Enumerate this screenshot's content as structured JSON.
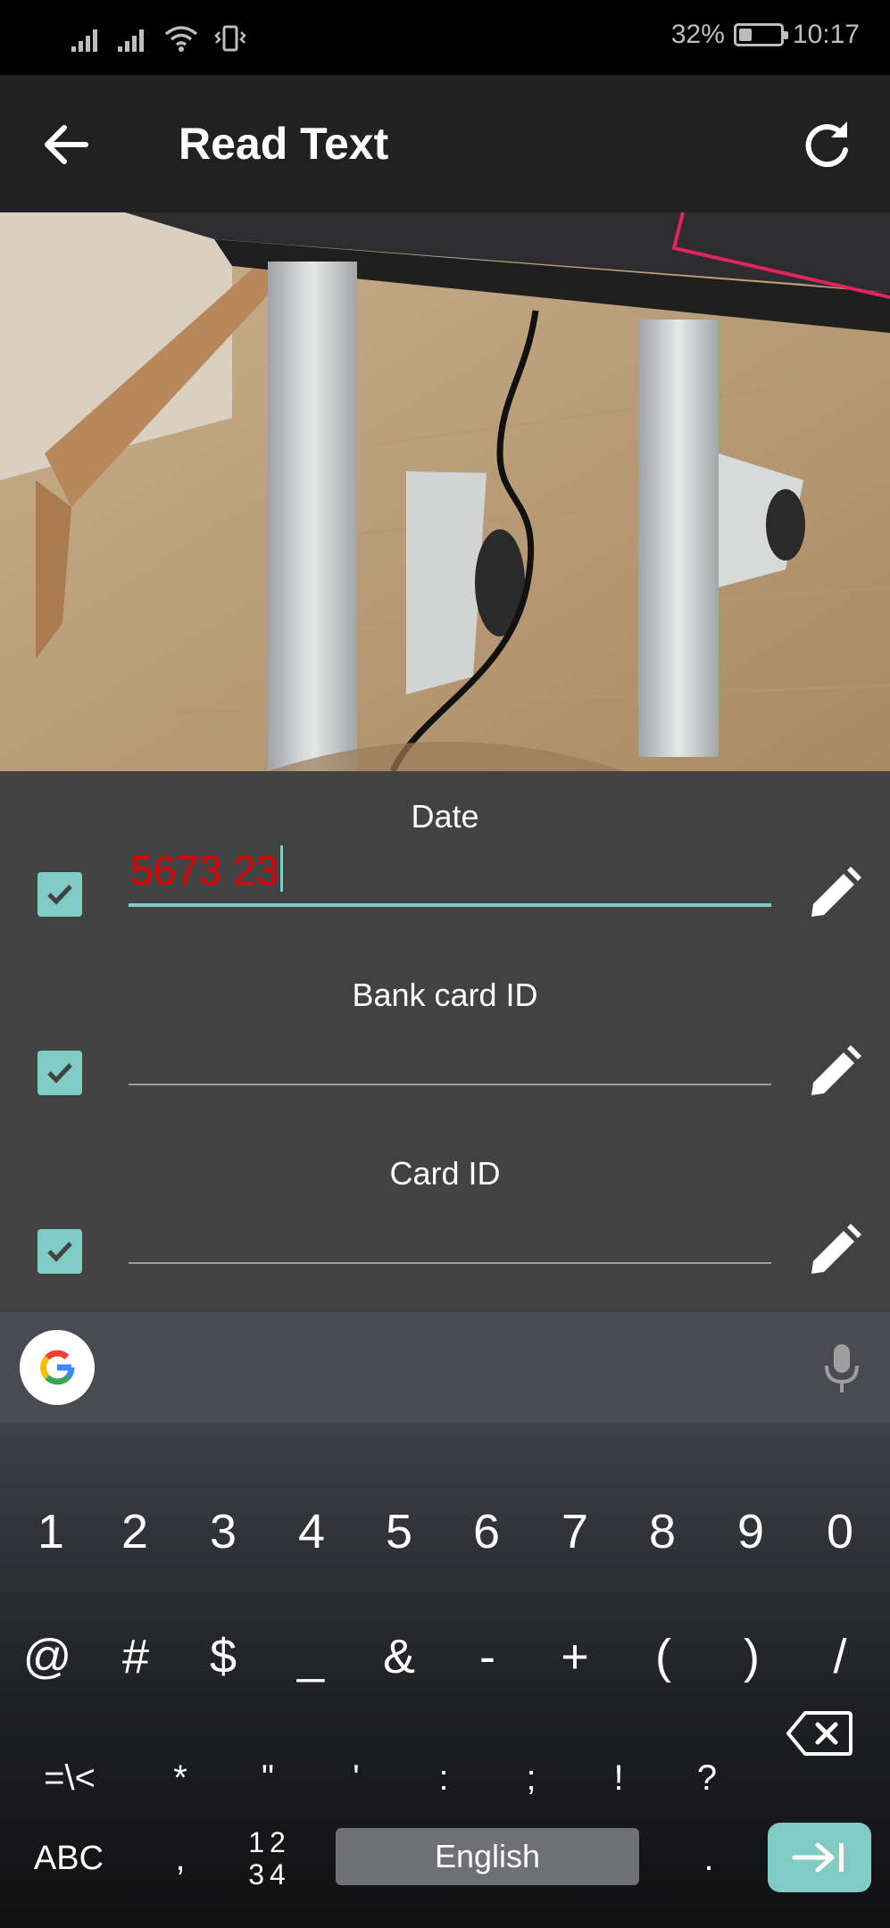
{
  "status_bar": {
    "battery_percent": "32%",
    "battery_level": 0.32,
    "time": "10:17",
    "icons": [
      "signal-1-icon",
      "signal-2-icon",
      "wifi-icon",
      "vibrate-icon",
      "battery-icon"
    ]
  },
  "toolbar": {
    "title": "Read Text",
    "back_icon": "arrow-back-icon",
    "refresh_icon": "refresh-icon"
  },
  "form": {
    "fields": [
      {
        "label": "Date",
        "value": "5673 23",
        "checked": true,
        "active": true
      },
      {
        "label": "Bank card ID",
        "value": "",
        "checked": true,
        "active": false
      },
      {
        "label": "Card ID",
        "value": "",
        "checked": true,
        "active": false
      }
    ],
    "colors": {
      "accent": "#80cbc4",
      "value_text": "#e00000",
      "panel": "#424242"
    }
  },
  "keyboard": {
    "row1": [
      "1",
      "2",
      "3",
      "4",
      "5",
      "6",
      "7",
      "8",
      "9",
      "0"
    ],
    "row2": [
      "@",
      "#",
      "$",
      "_",
      "&",
      "-",
      "+",
      "(",
      ")",
      "/"
    ],
    "row3": [
      "=\\<",
      "*",
      "\"",
      "'",
      ":",
      ";",
      "!",
      "?"
    ],
    "abc_label": "ABC",
    "comma_label": ",",
    "num_label_top": "12",
    "num_label_bottom": "34",
    "space_label": "English",
    "period_label": ".",
    "icons": [
      "google-icon",
      "mic-icon",
      "backspace-icon",
      "enter-icon"
    ]
  }
}
